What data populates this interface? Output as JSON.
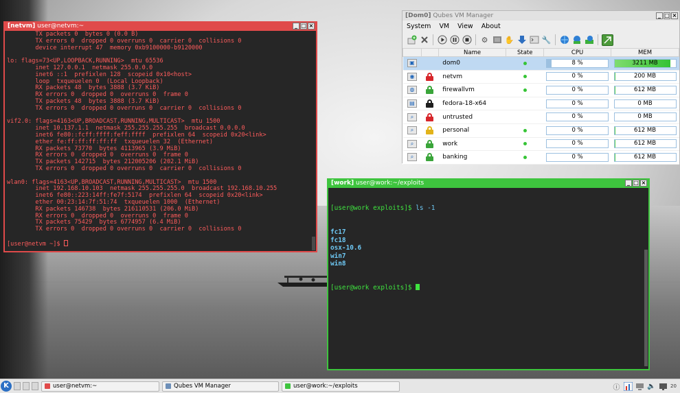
{
  "colors": {
    "netvm_frame": "#e04a4a",
    "work_frame": "#3ec43e",
    "netvm_text": "#ff5c5c",
    "work_text": "#6ec8f4",
    "prompt_green": "#3fe33f",
    "bar_blue": "#9cc0e0",
    "bar_green": "#34c234"
  },
  "netvm_window": {
    "title_host": "[netvm]",
    "title_rest": " user@netvm:~",
    "buttons": [
      "_",
      "□",
      "×"
    ],
    "lines": [
      "        TX packets 0  bytes 0 (0.0 B)",
      "        TX errors 0  dropped 0 overruns 0  carrier 0  collisions 0",
      "        device interrupt 47  memory 0xb9100000-b9120000",
      "",
      "lo: flags=73<UP,LOOPBACK,RUNNING>  mtu 65536",
      "        inet 127.0.0.1  netmask 255.0.0.0",
      "        inet6 ::1  prefixlen 128  scopeid 0x10<host>",
      "        loop  txqueuelen 0  (Local Loopback)",
      "        RX packets 48  bytes 3888 (3.7 KiB)",
      "        RX errors 0  dropped 0  overruns 0  frame 0",
      "        TX packets 48  bytes 3888 (3.7 KiB)",
      "        TX errors 0  dropped 0 overruns 0  carrier 0  collisions 0",
      "",
      "vif2.0: flags=4163<UP,BROADCAST,RUNNING,MULTICAST>  mtu 1500",
      "        inet 10.137.1.1  netmask 255.255.255.255  broadcast 0.0.0.0",
      "        inet6 fe80::fcff:ffff:feff:ffff  prefixlen 64  scopeid 0x20<link>",
      "        ether fe:ff:ff:ff:ff:ff  txqueuelen 32  (Ethernet)",
      "        RX packets 73770  bytes 4113965 (3.9 MiB)",
      "        RX errors 0  dropped 0  overruns 0  frame 0",
      "        TX packets 142715  bytes 212005206 (202.1 MiB)",
      "        TX errors 0  dropped 0 overruns 0  carrier 0  collisions 0",
      "",
      "wlan0: flags=4163<UP,BROADCAST,RUNNING,MULTICAST>  mtu 1500",
      "        inet 192.168.10.103  netmask 255.255.255.0  broadcast 192.168.10.255",
      "        inet6 fe80::223:14ff:fe7f:5174  prefixlen 64  scopeid 0x20<link>",
      "        ether 00:23:14:7f:51:74  txqueuelen 1000  (Ethernet)",
      "        RX packets 146738  bytes 216110531 (206.0 MiB)",
      "        RX errors 0  dropped 0  overruns 0  frame 0",
      "        TX packets 75429  bytes 6774957 (6.4 MiB)",
      "        TX errors 0  dropped 0 overruns 0  carrier 0  collisions 0",
      ""
    ],
    "prompt": "[user@netvm ~]$ "
  },
  "work_window": {
    "title_host": "[work]",
    "title_rest": " user@work:~/exploits",
    "buttons": [
      "_",
      "□",
      "×"
    ],
    "command_prompt": "[user@work exploits]$ ",
    "command": "ls -1",
    "files": [
      "fc17",
      "fc18",
      "osx-10.6",
      "win7",
      "win8"
    ],
    "prompt": "[user@work exploits]$ "
  },
  "qvm_window": {
    "title_host": "[Dom0]",
    "title_rest": " Qubes VM Manager",
    "buttons": [
      "_",
      "□",
      "×"
    ],
    "menu": [
      "System",
      "VM",
      "View",
      "About"
    ],
    "toolbar_icons": [
      "create-vm-icon",
      "remove-vm-icon",
      "start-vm-icon",
      "pause-vm-icon",
      "stop-vm-icon",
      "settings-icon",
      "show-logs-icon",
      "firewall-icon",
      "update-vm-icon",
      "terminal-icon",
      "tools-icon",
      "global-settings-icon",
      "backup-icon",
      "restore-icon",
      "show-hide-icon"
    ],
    "columns": [
      "",
      "",
      "Name",
      "State",
      "CPU",
      "MEM"
    ],
    "rows": [
      {
        "name": "dom0",
        "icon": "monitor-icon",
        "lock": "none",
        "running": true,
        "cpu_text": "8 %",
        "cpu": 0.08,
        "mem_text": "3211 MB",
        "mem": 0.92,
        "selected": true
      },
      {
        "name": "netvm",
        "icon": "network-vm-icon",
        "lock": "red",
        "running": true,
        "cpu_text": "0 %",
        "cpu": 0,
        "mem_text": "200 MB",
        "mem": 0.02,
        "selected": false
      },
      {
        "name": "firewallvm",
        "icon": "globe-vm-icon",
        "lock": "green",
        "running": true,
        "cpu_text": "0 %",
        "cpu": 0,
        "mem_text": "612 MB",
        "mem": 0.02,
        "selected": false
      },
      {
        "name": "fedora-18-x64",
        "icon": "template-vm-icon",
        "lock": "black",
        "running": false,
        "cpu_text": "0 %",
        "cpu": 0,
        "mem_text": "0 MB",
        "mem": 0,
        "selected": false
      },
      {
        "name": "untrusted",
        "icon": "appvm-icon",
        "lock": "red",
        "running": false,
        "cpu_text": "0 %",
        "cpu": 0,
        "mem_text": "0 MB",
        "mem": 0,
        "selected": false
      },
      {
        "name": "personal",
        "icon": "appvm-icon",
        "lock": "yellow",
        "running": true,
        "cpu_text": "0 %",
        "cpu": 0,
        "mem_text": "612 MB",
        "mem": 0.02,
        "selected": false
      },
      {
        "name": "work",
        "icon": "appvm-icon",
        "lock": "green",
        "running": true,
        "cpu_text": "0 %",
        "cpu": 0,
        "mem_text": "612 MB",
        "mem": 0.02,
        "selected": false
      },
      {
        "name": "banking",
        "icon": "appvm-icon",
        "lock": "green",
        "running": true,
        "cpu_text": "0 %",
        "cpu": 0,
        "mem_text": "612 MB",
        "mem": 0.02,
        "selected": false
      }
    ]
  },
  "taskbar": {
    "tasks": [
      {
        "label": "user@netvm:~",
        "color": "#e04a4a"
      },
      {
        "label": "Qubes VM Manager",
        "color": "#6d8fb8"
      },
      {
        "label": "user@work:~/exploits",
        "color": "#3ec43e"
      }
    ],
    "tray_icons": [
      "info-icon",
      "network-monitor-icon",
      "network-icon",
      "volume-icon",
      "display-icon"
    ],
    "clock": "20"
  }
}
